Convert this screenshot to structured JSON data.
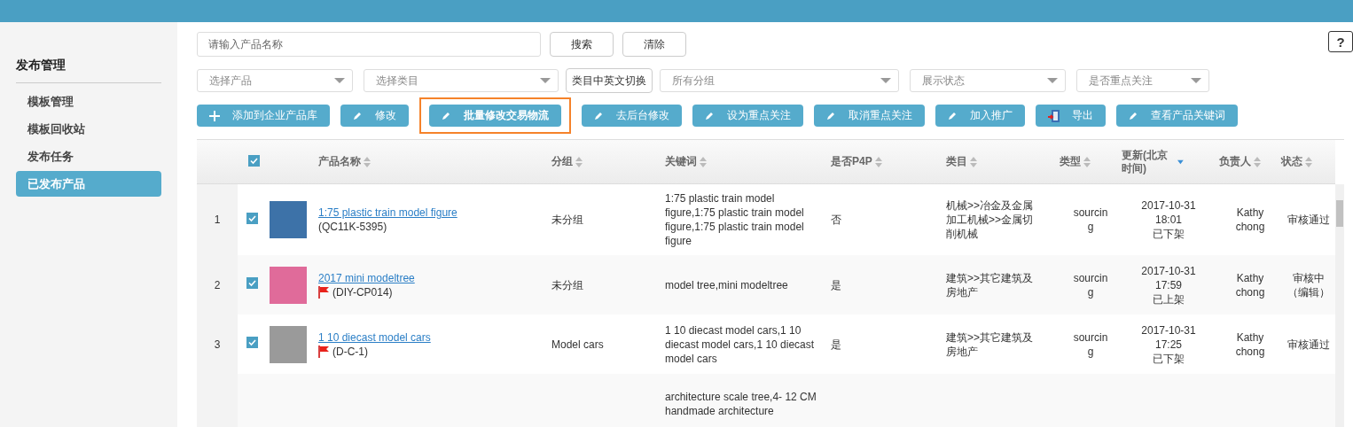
{
  "sidebar": {
    "title": "发布管理",
    "items": [
      {
        "label": "模板管理",
        "selected": false
      },
      {
        "label": "模板回收站",
        "selected": false
      },
      {
        "label": "发布任务",
        "selected": false
      },
      {
        "label": "已发布产品",
        "selected": true
      }
    ]
  },
  "help": "?",
  "search": {
    "placeholder": "请输入产品名称",
    "buttons": [
      "搜索",
      "清除"
    ]
  },
  "filters": [
    {
      "kind": "select",
      "placeholder": "选择产品"
    },
    {
      "kind": "select",
      "placeholder": "选择类目"
    },
    {
      "kind": "button",
      "label": "类目中英文切换"
    },
    {
      "kind": "select",
      "placeholder": "所有分组"
    },
    {
      "kind": "select",
      "placeholder": "展示状态"
    },
    {
      "kind": "select",
      "placeholder": "是否重点关注"
    }
  ],
  "actions": [
    {
      "kind": "add",
      "label": "添加到企业产品库",
      "highlighted": false
    },
    {
      "kind": "edit",
      "label": "修改",
      "highlighted": false
    },
    {
      "kind": "edit",
      "label": "批量修改交易物流",
      "highlighted": true
    },
    {
      "kind": "edit",
      "label": "去后台修改",
      "highlighted": false
    },
    {
      "kind": "edit",
      "label": "设为重点关注",
      "highlighted": false
    },
    {
      "kind": "edit",
      "label": "取消重点关注",
      "highlighted": false
    },
    {
      "kind": "edit",
      "label": "加入推广",
      "highlighted": false
    },
    {
      "kind": "export",
      "label": "导出",
      "highlighted": false
    },
    {
      "kind": "edit",
      "label": "查看产品关键词",
      "highlighted": false
    }
  ],
  "table": {
    "all_checked": true,
    "columns": [
      {
        "label": "产品名称",
        "sorted": false
      },
      {
        "label": "分组",
        "sorted": false
      },
      {
        "label": "关键词",
        "sorted": false
      },
      {
        "label": "是否P4P",
        "sorted": false
      },
      {
        "label": "类目",
        "sorted": false
      },
      {
        "label": "类型",
        "sorted": false
      },
      {
        "label": "更新(北京时间)",
        "sorted": true
      },
      {
        "label": "负责人",
        "sorted": false
      },
      {
        "label": "状态",
        "sorted": false
      }
    ],
    "rows": [
      {
        "index": "1",
        "checked": true,
        "name": "1:75 plastic train model figure",
        "code": "(QC11K-5395)",
        "flagged": false,
        "group": "未分组",
        "keywords": "1:75 plastic train model figure,1:75 plastic train model figure,1:75 plastic train model figure",
        "p4p": "否",
        "category": "机械>>冶金及金属加工机械>>金属切削机械",
        "type": "sourcing",
        "date": "2017-10-31",
        "time": "18:01",
        "shelf": "已下架",
        "owner": "Kathy chong",
        "status": "审核通过"
      },
      {
        "index": "2",
        "checked": true,
        "name": "2017 mini modeltree",
        "code": "(DIY-CP014)",
        "flagged": true,
        "group": "未分组",
        "keywords": "model tree,mini modeltree",
        "p4p": "是",
        "category": "建筑>>其它建筑及房地产",
        "type": "sourcing",
        "date": "2017-10-31",
        "time": "17:59",
        "shelf": "已上架",
        "owner": "Kathy chong",
        "status": "审核中（编辑）"
      },
      {
        "index": "3",
        "checked": true,
        "name": "1 10 diecast model cars",
        "code": "(D-C-1)",
        "flagged": true,
        "group": "Model cars",
        "keywords": "1 10 diecast model cars,1 10 diecast model cars,1 10 diecast model cars",
        "p4p": "是",
        "category": "建筑>>其它建筑及房地产",
        "type": "sourcing",
        "date": "2017-10-31",
        "time": "17:25",
        "shelf": "已下架",
        "owner": "Kathy chong",
        "status": "审核通过"
      },
      {
        "keywords": "architecture scale tree,4- 12 CM handmade architecture"
      }
    ]
  }
}
